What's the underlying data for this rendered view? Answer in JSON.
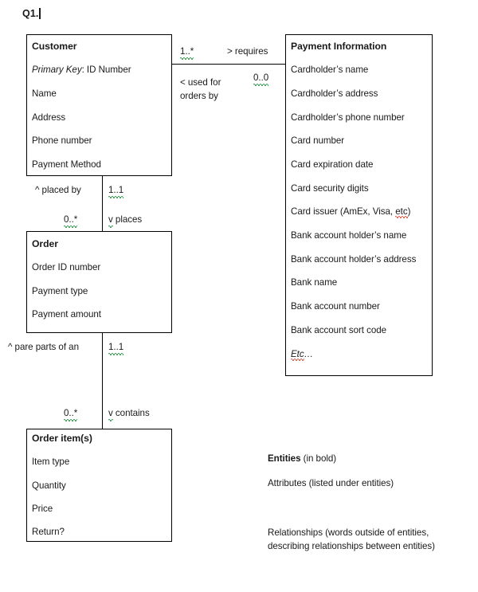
{
  "document": {
    "title": "Q1."
  },
  "entities": [
    {
      "name": "Customer",
      "attributes": [
        {
          "label_italic": "Primary Key",
          "label_rest": ": ID Number"
        },
        {
          "label": "Name"
        },
        {
          "label": "Address"
        },
        {
          "label": "Phone number"
        },
        {
          "label": "Payment Method"
        }
      ]
    },
    {
      "name": "Payment Information",
      "attributes": [
        {
          "label": "Cardholder’s name"
        },
        {
          "label": "Cardholder’s address"
        },
        {
          "label": "Cardholder’s phone number"
        },
        {
          "label": "Card number"
        },
        {
          "label": "Card expiration date"
        },
        {
          "label": "Card security digits"
        },
        {
          "label_pre": "Card issuer (AmEx, Visa, ",
          "label_misspelled": "etc",
          "label_post": ")"
        },
        {
          "label": "Bank account holder’s name"
        },
        {
          "label": "Bank account holder’s address"
        },
        {
          "label": "Bank name"
        },
        {
          "label": "Bank account number"
        },
        {
          "label": "Bank account sort code"
        },
        {
          "label_misspelled": "Etc",
          "label_post": "…",
          "italic": true
        }
      ]
    },
    {
      "name": "Order",
      "attributes": [
        {
          "label": "Order ID number"
        },
        {
          "label": "Payment type"
        },
        {
          "label": "Payment amount"
        }
      ]
    },
    {
      "name": "Order item(s)",
      "attributes": [
        {
          "label": "Item type"
        },
        {
          "label": "Quantity"
        },
        {
          "label": "Price"
        },
        {
          "label": "Return?"
        }
      ]
    }
  ],
  "relationships": {
    "customer_payment": {
      "cardinality_left": "1..*",
      "verb_right": "> requires",
      "verb_left_line1": "< used for",
      "verb_left_line2": "orders by",
      "cardinality_right": "0..0"
    },
    "customer_order": {
      "verb_up": "^ placed by",
      "cardinality_up": "1..1",
      "cardinality_down": "0..*",
      "verb_down_marker": "v",
      "verb_down_text": " places"
    },
    "order_orderitem": {
      "verb_up": "^ pare parts of an",
      "cardinality_up": "1..1",
      "cardinality_down": "0..*",
      "verb_down_marker": "v",
      "verb_down_text": " contains"
    }
  },
  "legend": {
    "entities_bold": "Entities",
    "entities_rest": " (in bold)",
    "attributes": "Attributes (listed under entities)",
    "relationships": "Relationships (words outside of entities, describing relationships between entities)"
  }
}
